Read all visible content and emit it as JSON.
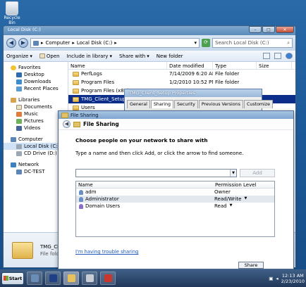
{
  "desktop": {
    "recycle_label": "Recycle Bin"
  },
  "explorer": {
    "title": "Local Disk (C:)",
    "address": [
      "Computer",
      "Local Disk (C:)"
    ],
    "search_placeholder": "Search Local Disk (C:)",
    "toolbar": [
      "Organize",
      "Open",
      "Include in library",
      "Share with",
      "New folder"
    ],
    "nav": [
      {
        "label": "Favorites",
        "icon": "star-icon",
        "level": 0
      },
      {
        "label": "Desktop",
        "icon": "desktop-icon",
        "level": 1
      },
      {
        "label": "Downloads",
        "icon": "downloads-icon",
        "level": 1
      },
      {
        "label": "Recent Places",
        "icon": "recent-places-icon",
        "level": 1
      },
      {
        "label": "Libraries",
        "icon": "libraries-icon",
        "level": 0,
        "gap": true
      },
      {
        "label": "Documents",
        "icon": "documents-icon",
        "level": 1
      },
      {
        "label": "Music",
        "icon": "music-icon",
        "level": 1
      },
      {
        "label": "Pictures",
        "icon": "pictures-icon",
        "level": 1
      },
      {
        "label": "Videos",
        "icon": "videos-icon",
        "level": 1
      },
      {
        "label": "Computer",
        "icon": "computer-icon",
        "level": 0,
        "gap": true
      },
      {
        "label": "Local Disk (C:)",
        "icon": "drive-icon",
        "level": 1,
        "selected": true
      },
      {
        "label": "CD Drive (D:) TMGSE",
        "icon": "cd-drive-icon",
        "level": 1
      },
      {
        "label": "Network",
        "icon": "network-icon",
        "level": 0,
        "gap": true
      },
      {
        "label": "DC-TEST",
        "icon": "network-computer-icon",
        "level": 1
      }
    ],
    "columns": [
      "Name",
      "Date modified",
      "Type",
      "Size"
    ],
    "files": [
      {
        "name": "PerfLogs",
        "date": "7/14/2009 6:20 AM",
        "type": "File folder"
      },
      {
        "name": "Program Files",
        "date": "1/2/2010 10:52 PM",
        "type": "File folder"
      },
      {
        "name": "Program Files (x86)",
        "date": "",
        "type": ""
      },
      {
        "name": "TMG_Client_Setup",
        "date": "",
        "type": "",
        "selected": true
      },
      {
        "name": "Users",
        "date": "",
        "type": ""
      }
    ],
    "details": {
      "name": "TMG_Client_S",
      "type": "File folder"
    }
  },
  "properties": {
    "title": "TMG_Client_Setup Properties",
    "tabs": [
      "General",
      "Sharing",
      "Security",
      "Previous Versions",
      "Customize"
    ],
    "active_tab": "Sharing"
  },
  "share_dialog": {
    "title": "File Sharing",
    "header": "File Sharing",
    "heading": "Choose people on your network to share with",
    "instruction": "Type a name and then click Add, or click the arrow to find someone.",
    "add_label": "Add",
    "table_headers": [
      "Name",
      "Permission Level"
    ],
    "users": [
      {
        "name": "adm",
        "permission": "Owner",
        "dropdown": false,
        "icon": "user-icon"
      },
      {
        "name": "Administrator",
        "permission": "Read/Write",
        "dropdown": true,
        "icon": "user-icon",
        "selected": true
      },
      {
        "name": "Domain Users",
        "permission": "Read",
        "dropdown": true,
        "icon": "group-icon"
      }
    ],
    "help_link": "I'm having trouble sharing",
    "share_button": "Share"
  },
  "taskbar": {
    "start_label": "Start",
    "time": "12:13 AM",
    "date": "2/23/2010"
  }
}
